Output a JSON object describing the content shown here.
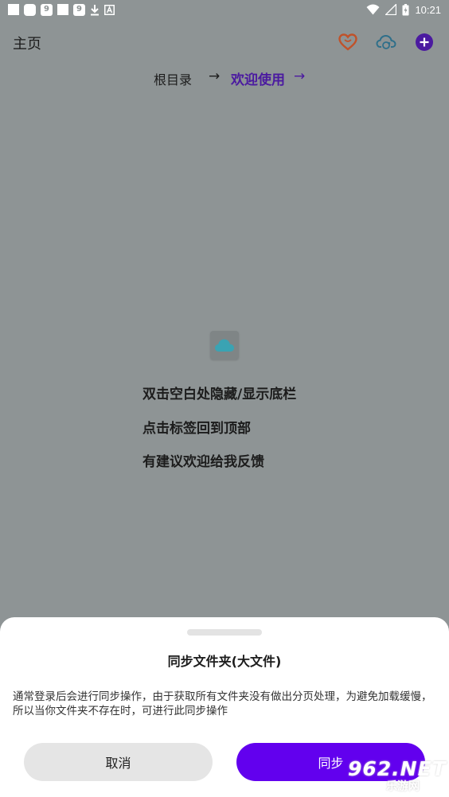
{
  "status_bar": {
    "time": "10:21",
    "left_icons": [
      "notification-square-icon",
      "app-rounded-icon",
      "app-9-icon",
      "notification-square-icon",
      "app-9-icon",
      "download-icon",
      "accessibility-icon"
    ],
    "right_icons": [
      "wifi-icon",
      "signal-icon",
      "battery-icon"
    ],
    "badge_text": "9"
  },
  "topbar": {
    "title": "主页",
    "icons": [
      "heart-icon",
      "cloud-sync-icon",
      "add-circle-icon"
    ]
  },
  "breadcrumb": {
    "root": "根目录",
    "separator": "→",
    "current": "欢迎使用",
    "current_arrow": "→"
  },
  "empty_state": {
    "icon": "cloud-icon",
    "hints": [
      "双击空白处隐藏/显示底栏",
      "点击标签回到顶部",
      "有建议欢迎给我反馈"
    ]
  },
  "sheet": {
    "title": "同步文件夹(大文件)",
    "body": "通常登录后会进行同步操作，由于获取所有文件夹没有做出分页处理，为避免加载缓慢，所以当你文件夹不存在时，可进行此同步操作",
    "cancel_label": "取消",
    "confirm_label": "同步"
  },
  "watermark": {
    "main": "962.NET",
    "sub": "乐游网"
  },
  "colors": {
    "accent": "#6200ee",
    "breadcrumb_current": "#4b1aa0",
    "heart": "#c0522a",
    "cloud_sync": "#2f6f8a",
    "cloud_icon": "#3aa3b3",
    "scrim": "#8e9495",
    "sheet_bg": "#ffffff",
    "cancel_bg": "#e5e5e5"
  }
}
